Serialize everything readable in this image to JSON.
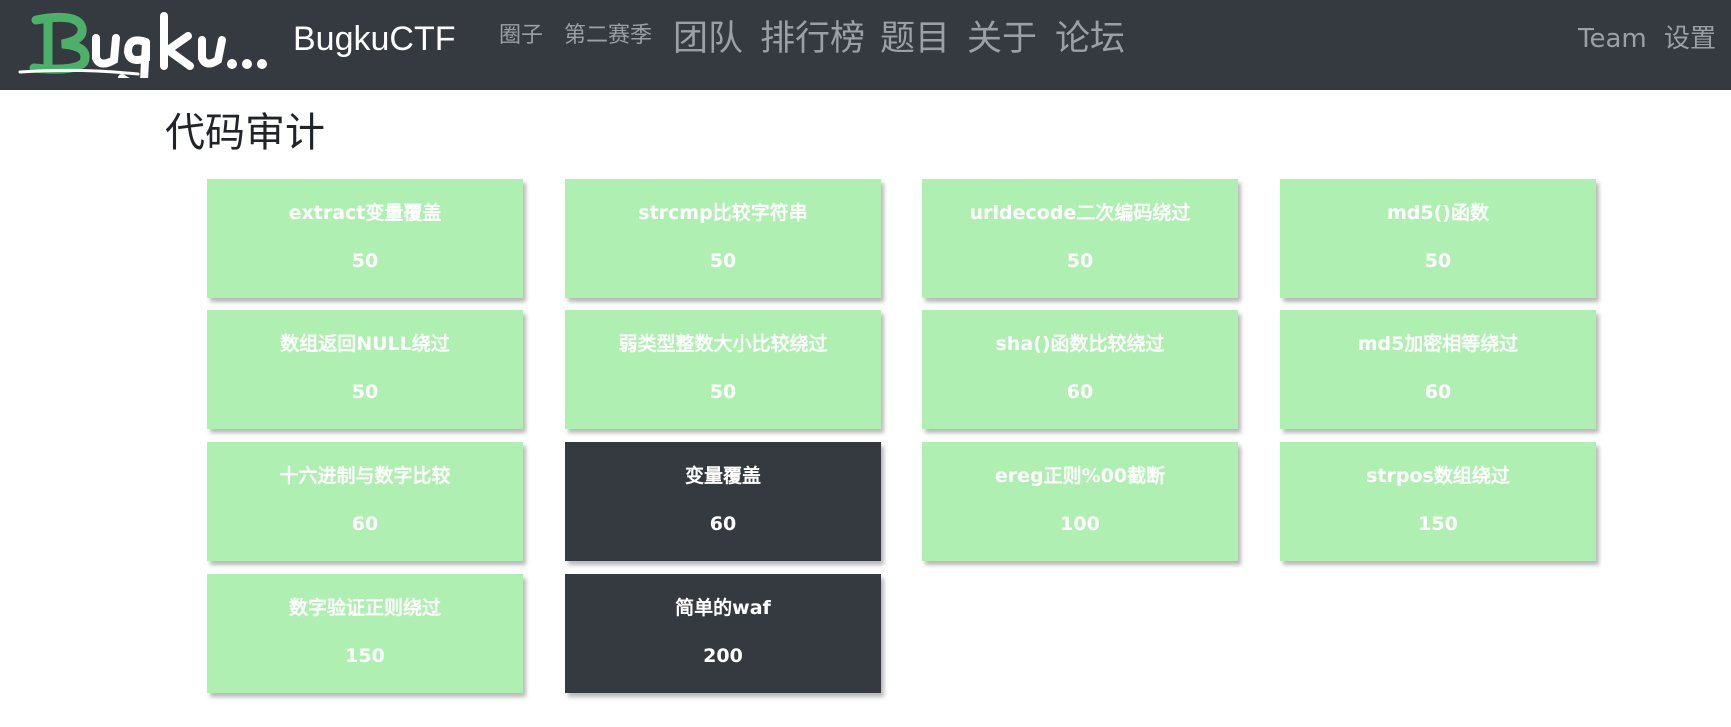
{
  "navbar": {
    "logo_text": "Bugku...",
    "brand": "BugkuCTF",
    "links_small": [
      "圈子",
      "第二赛季"
    ],
    "links_large": [
      "团队",
      "排行榜",
      "题目",
      "关于",
      "论坛"
    ],
    "links_right": [
      "Team",
      "设置"
    ]
  },
  "page": {
    "title": "代码审计"
  },
  "challenges": [
    {
      "name": "extract变量覆盖",
      "score": "50",
      "solved": false
    },
    {
      "name": "strcmp比较字符串",
      "score": "50",
      "solved": false
    },
    {
      "name": "urldecode二次编码绕过",
      "score": "50",
      "solved": false
    },
    {
      "name": "md5()函数",
      "score": "50",
      "solved": false
    },
    {
      "name": "数组返回NULL绕过",
      "score": "50",
      "solved": false
    },
    {
      "name": "弱类型整数大小比较绕过",
      "score": "50",
      "solved": false
    },
    {
      "name": "sha()函数比较绕过",
      "score": "60",
      "solved": false
    },
    {
      "name": "md5加密相等绕过",
      "score": "60",
      "solved": false
    },
    {
      "name": "十六进制与数字比较",
      "score": "60",
      "solved": false
    },
    {
      "name": "变量覆盖",
      "score": "60",
      "solved": true
    },
    {
      "name": "ereg正则%00截断",
      "score": "100",
      "solved": false
    },
    {
      "name": "strpos数组绕过",
      "score": "150",
      "solved": false
    },
    {
      "name": "数字验证正则绕过",
      "score": "150",
      "solved": false
    },
    {
      "name": "简单的waf",
      "score": "200",
      "solved": true
    }
  ],
  "colors": {
    "navbar_bg": "#343a40",
    "card_unsolved": "#b0efb2",
    "card_solved": "#343a40"
  }
}
